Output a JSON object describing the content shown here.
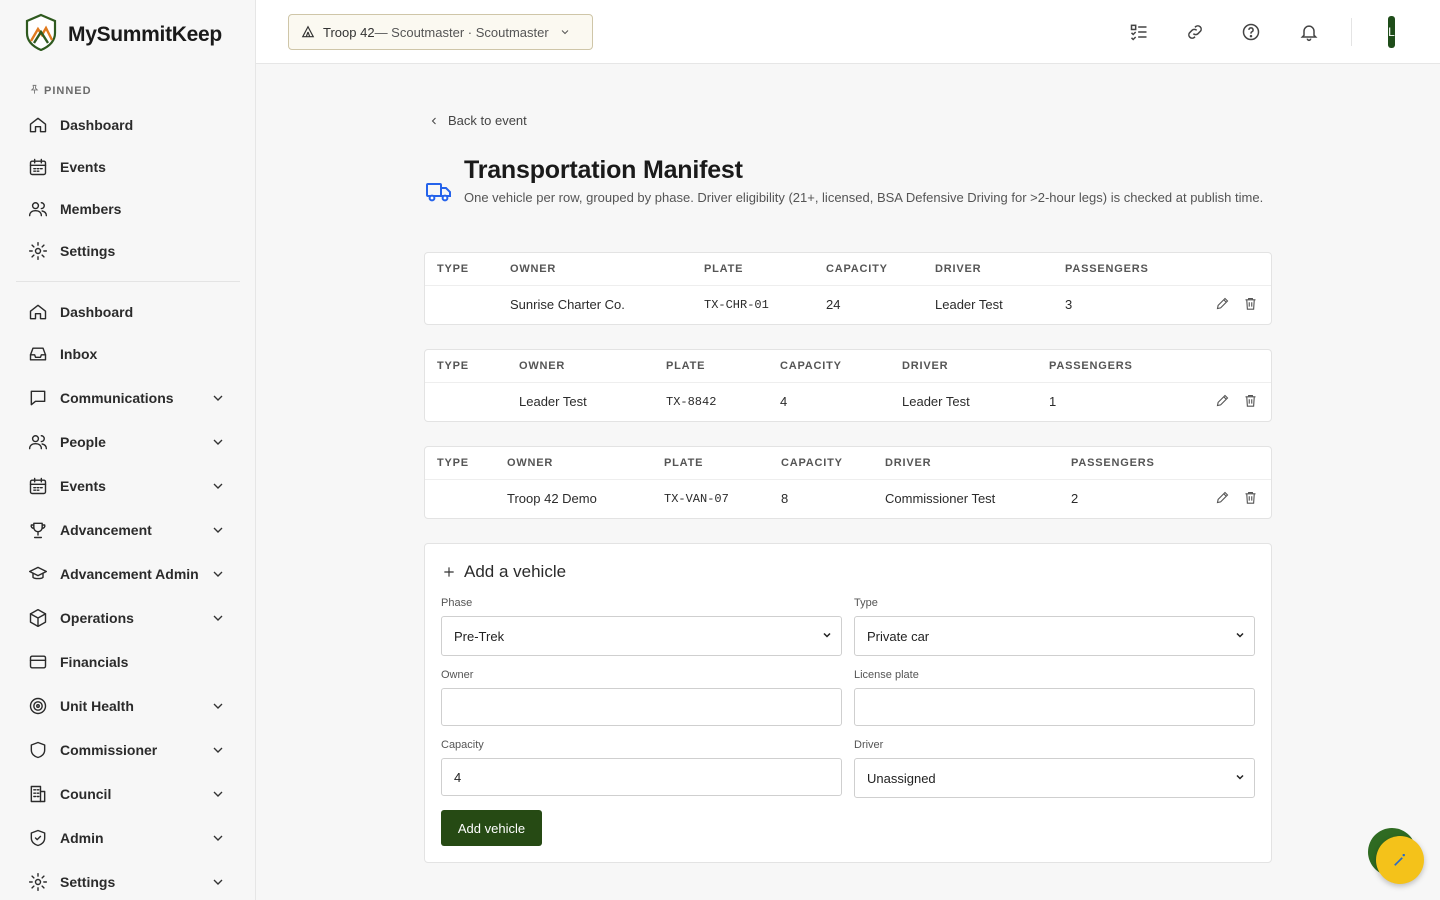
{
  "brand": {
    "name": "MySummitKeep"
  },
  "sidebar": {
    "pinned_label": "PINNED",
    "pinned": [
      {
        "label": "Dashboard",
        "icon": "home-icon"
      },
      {
        "label": "Events",
        "icon": "calendar-icon"
      },
      {
        "label": "Members",
        "icon": "users-icon"
      },
      {
        "label": "Settings",
        "icon": "gear-icon"
      }
    ],
    "items": [
      {
        "label": "Dashboard",
        "icon": "home-icon"
      },
      {
        "label": "Inbox",
        "icon": "inbox-icon"
      },
      {
        "label": "Communications",
        "icon": "chat-icon",
        "expandable": true
      },
      {
        "label": "People",
        "icon": "users-icon",
        "expandable": true
      },
      {
        "label": "Events",
        "icon": "calendar-icon",
        "expandable": true
      },
      {
        "label": "Advancement",
        "icon": "trophy-icon",
        "expandable": true
      },
      {
        "label": "Advancement Admin",
        "icon": "graduation-cap-icon",
        "expandable": true
      },
      {
        "label": "Operations",
        "icon": "box-icon",
        "expandable": true
      },
      {
        "label": "Financials",
        "icon": "credit-card-icon"
      },
      {
        "label": "Unit Health",
        "icon": "target-icon",
        "expandable": true
      },
      {
        "label": "Commissioner",
        "icon": "shield-icon",
        "expandable": true
      },
      {
        "label": "Council",
        "icon": "building-icon",
        "expandable": true
      },
      {
        "label": "Admin",
        "icon": "shield-check-icon",
        "expandable": true
      },
      {
        "label": "Settings",
        "icon": "gear-icon",
        "expandable": true
      }
    ]
  },
  "topbar": {
    "troop": "Troop 42",
    "troop_role": " — Scoutmaster · Scoutmaster",
    "avatar_initial": "L"
  },
  "page": {
    "back_label": "Back to event",
    "title": "Transportation Manifest",
    "subtitle": "One vehicle per row, grouped by phase. Driver eligibility (21+, licensed, BSA Defensive Driving for >2-hour legs) is checked at publish time."
  },
  "table_headers": [
    "TYPE",
    "OWNER",
    "PLATE",
    "CAPACITY",
    "DRIVER",
    "PASSENGERS"
  ],
  "vehicles": [
    {
      "type": "",
      "owner": "Sunrise Charter Co.",
      "plate": "TX-CHR-01",
      "capacity": "24",
      "driver": "Leader Test",
      "passengers": "3"
    },
    {
      "type": "",
      "owner": "Leader Test",
      "plate": "TX-8842",
      "capacity": "4",
      "driver": "Leader Test",
      "passengers": "1"
    },
    {
      "type": "",
      "owner": "Troop 42 Demo",
      "plate": "TX-VAN-07",
      "capacity": "8",
      "driver": "Commissioner Test",
      "passengers": "2"
    }
  ],
  "add_form": {
    "title": "Add a vehicle",
    "phase_label": "Phase",
    "phase_value": "Pre-Trek",
    "type_label": "Type",
    "type_value": "Private car",
    "owner_label": "Owner",
    "owner_value": "",
    "plate_label": "License plate",
    "plate_value": "",
    "capacity_label": "Capacity",
    "capacity_value": "4",
    "driver_label": "Driver",
    "driver_value": "Unassigned",
    "submit_label": "Add vehicle"
  },
  "colors": {
    "accent": "#264a14",
    "fab": "#f4c21a",
    "title_icon": "#2563eb"
  }
}
